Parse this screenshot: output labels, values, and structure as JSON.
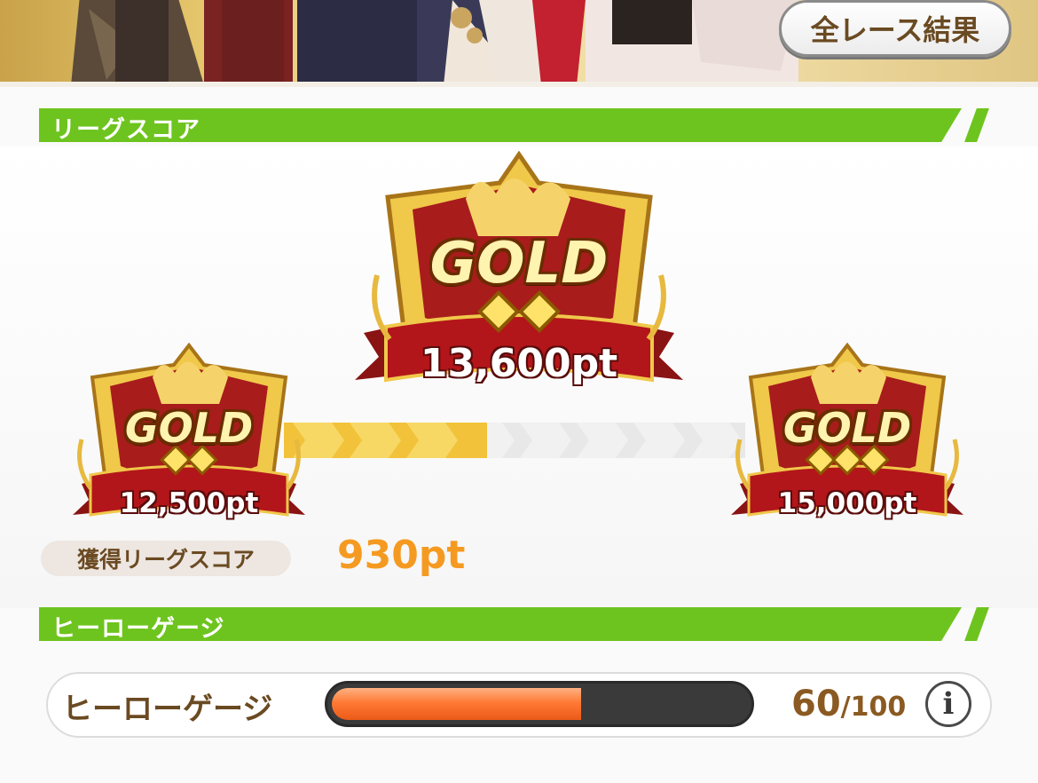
{
  "header": {
    "all_results_label": "全レース結果"
  },
  "league_section": {
    "title": "リーグスコア"
  },
  "current_rank": {
    "tier": "GOLD",
    "diamonds": 2,
    "points": "13,600pt"
  },
  "previous_rank": {
    "tier": "GOLD",
    "diamonds": 2,
    "points": "12,500pt"
  },
  "next_rank": {
    "tier": "GOLD",
    "diamonds": 3,
    "points": "15,000pt"
  },
  "progress": {
    "filled_fraction": 0.44
  },
  "earned": {
    "label": "獲得リーグスコア",
    "value": "930pt"
  },
  "hero_section": {
    "title": "ヒーローゲージ"
  },
  "hero_gauge": {
    "label": "ヒーローゲージ",
    "current": 60,
    "max": 100,
    "current_text": "60",
    "max_text": "/100",
    "info_icon": "i"
  },
  "colors": {
    "accent_green": "#6ec41e",
    "score_orange": "#f59a21",
    "gauge_orange": "#ff7a36",
    "badge_red": "#a51a1a",
    "gold": "#f3c23a"
  }
}
